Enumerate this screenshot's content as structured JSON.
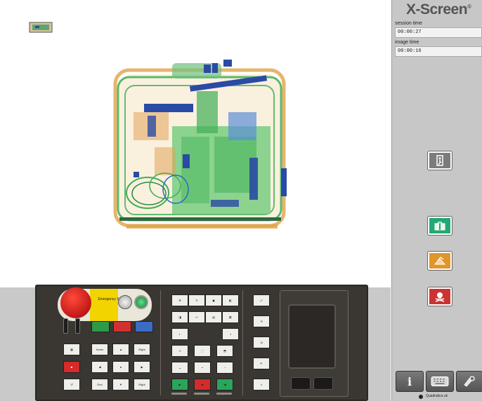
{
  "sidebar": {
    "brand": "X-Screen",
    "brand_mark": "®",
    "session_time_label": "session time",
    "session_time_value": "00:00:27",
    "image_time_label": "image time",
    "image_time_value": "00:00:16",
    "maker": "Quadratica uk",
    "buttons": [
      {
        "name": "exit-button",
        "icon": "exit-door-icon",
        "color": "#7c7c7c"
      },
      {
        "name": "clear-bag-button",
        "icon": "bag-icon",
        "color": "#23a873"
      },
      {
        "name": "suspect-button",
        "icon": "hand-bag-icon",
        "color": "#e0962a"
      },
      {
        "name": "threat-button",
        "icon": "skull-icon",
        "color": "#cc3333"
      }
    ],
    "footer_buttons": [
      {
        "name": "info-button",
        "icon": "info-icon",
        "label": "i"
      },
      {
        "name": "keyboard-button",
        "icon": "keyboard-icon"
      },
      {
        "name": "extra-button",
        "icon": "tools-icon"
      }
    ]
  },
  "panel": {
    "emergency_label": "Emergency Stop",
    "buttons_left": [
      "Home",
      "Right",
      "End",
      "Right"
    ],
    "color_buttons": [
      "#2e9a48",
      "#d23030",
      "#3a6cc4"
    ],
    "accent_red": "#d42c2c",
    "accent_green": "#2aa55a"
  }
}
